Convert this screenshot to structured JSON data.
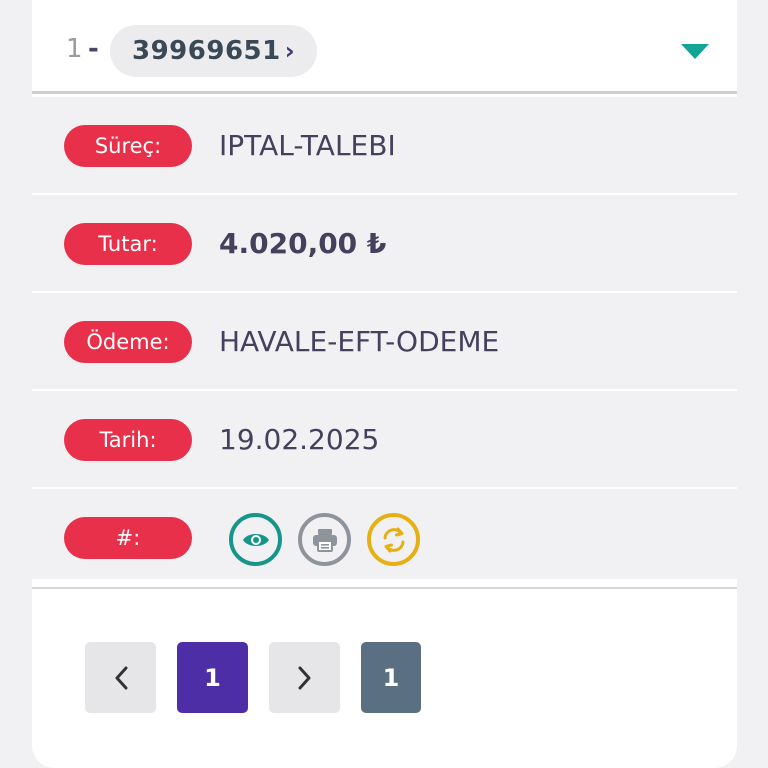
{
  "header": {
    "index": "1",
    "dash": "-",
    "order_number": "39969651",
    "chevron": "›"
  },
  "rows": [
    {
      "label": "Süreç:",
      "value": "IPTAL-TALEBI",
      "bold": false
    },
    {
      "label": "Tutar:",
      "value": "4.020,00 ₺",
      "bold": true
    },
    {
      "label": "Ödeme:",
      "value": "HAVALE-EFT-ODEME",
      "bold": false
    },
    {
      "label": "Tarih:",
      "value": "19.02.2025",
      "bold": false
    }
  ],
  "actions_row": {
    "label": "#:",
    "icons": [
      "eye-icon",
      "printer-icon",
      "sync-icon"
    ],
    "colors": {
      "view": "#16968a",
      "print": "#8e949c",
      "sync": "#e6b014"
    }
  },
  "pagination": {
    "current_page": "1",
    "total_pages": "1"
  },
  "colors": {
    "label_bg": "#e8304a",
    "accent_teal": "#12a596",
    "current_page_bg": "#4d2ea6",
    "total_pages_bg": "#5a6f82"
  }
}
